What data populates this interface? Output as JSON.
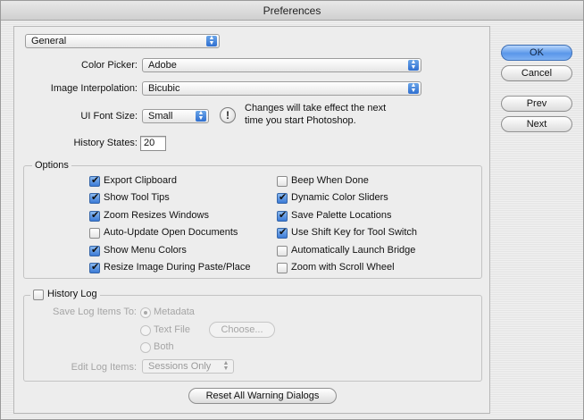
{
  "window": {
    "title": "Preferences"
  },
  "section_popup": {
    "value": "General"
  },
  "color_picker": {
    "label": "Color Picker:",
    "value": "Adobe"
  },
  "image_interpolation": {
    "label": "Image Interpolation:",
    "value": "Bicubic"
  },
  "ui_font_size": {
    "label": "UI Font Size:",
    "value": "Small",
    "note_line1": "Changes will take effect the next",
    "note_line2": "time you start Photoshop."
  },
  "history_states": {
    "label": "History States:",
    "value": "20"
  },
  "options": {
    "title": "Options",
    "left": [
      {
        "label": "Export Clipboard",
        "checked": true
      },
      {
        "label": "Show Tool Tips",
        "checked": true
      },
      {
        "label": "Zoom Resizes Windows",
        "checked": true
      },
      {
        "label": "Auto-Update Open Documents",
        "checked": false
      },
      {
        "label": "Show Menu Colors",
        "checked": true
      },
      {
        "label": "Resize Image During Paste/Place",
        "checked": true
      }
    ],
    "right": [
      {
        "label": "Beep When Done",
        "checked": false
      },
      {
        "label": "Dynamic Color Sliders",
        "checked": true
      },
      {
        "label": "Save Palette Locations",
        "checked": true
      },
      {
        "label": "Use Shift Key for Tool Switch",
        "checked": true
      },
      {
        "label": "Automatically Launch Bridge",
        "checked": false
      },
      {
        "label": "Zoom with Scroll Wheel",
        "checked": false
      }
    ]
  },
  "history_log": {
    "title": "History Log",
    "checked": false,
    "save_to_label": "Save Log Items To:",
    "radio_metadata": "Metadata",
    "radio_text_file": "Text File",
    "choose_button": "Choose...",
    "radio_both": "Both",
    "edit_label": "Edit Log Items:",
    "edit_value": "Sessions Only"
  },
  "reset_button": "Reset All Warning Dialogs",
  "buttons": {
    "ok": "OK",
    "cancel": "Cancel",
    "prev": "Prev",
    "next": "Next"
  }
}
